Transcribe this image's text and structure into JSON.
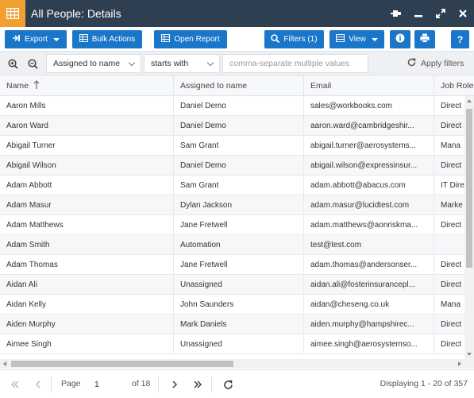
{
  "window": {
    "title": "All People: Details",
    "icons": {
      "app": "grid-table-icon",
      "pin": "pin-icon",
      "minimize": "minimize-icon",
      "maximize": "expand-icon",
      "close": "close-icon"
    }
  },
  "colors": {
    "titlebar": "#2f3f52",
    "app_icon_bg": "#f0a030",
    "button": "#1976c8"
  },
  "toolbar": {
    "export_label": "Export",
    "bulk_actions_label": "Bulk Actions",
    "open_report_label": "Open Report",
    "filters_label": "Filters (1)",
    "view_label": "View"
  },
  "filter": {
    "field_value": "Assigned to name",
    "operator_value": "starts with",
    "value_placeholder": "comma-separate multiple values",
    "apply_label": "Apply filters"
  },
  "grid": {
    "columns": [
      "Name",
      "Assigned to name",
      "Email",
      "Job Role"
    ],
    "rows": [
      [
        "Aaron Mills",
        "Daniel Demo",
        "sales@workbooks.com",
        "Direct"
      ],
      [
        "Aaron Ward",
        "Daniel Demo",
        "aaron.ward@cambridgeshir...",
        "Direct"
      ],
      [
        "Abigail Turner",
        "Sam Grant",
        "abigail.turner@aerosystems...",
        "Mana"
      ],
      [
        "Abigail Wilson",
        "Daniel Demo",
        "abigail.wilson@expressinsur...",
        "Direct"
      ],
      [
        "Adam Abbott",
        "Sam Grant",
        "adam.abbott@abacus.com",
        "IT Dire"
      ],
      [
        "Adam Masur",
        "Dylan Jackson",
        "adam.masur@lucidtest.com",
        "Marke"
      ],
      [
        "Adam Matthews",
        "Jane Fretwell",
        "adam.matthews@aonriskma...",
        "Direct"
      ],
      [
        "Adam Smith",
        "Automation",
        "test@test.com",
        ""
      ],
      [
        "Adam Thomas",
        "Jane Fretwell",
        "adam.thomas@andersonser...",
        "Direct"
      ],
      [
        "Aidan Ali",
        "Unassigned",
        "aidan.ali@fosterinsurancepl...",
        "Direct"
      ],
      [
        "Aidan Kelly",
        "John Saunders",
        "aidan@cheseng.co.uk",
        "Mana"
      ],
      [
        "Aiden Murphy",
        "Mark Daniels",
        "aiden.murphy@hampshirec...",
        "Direct"
      ],
      [
        "Aimee Singh",
        "Unassigned",
        "aimee.singh@aerosystemso...",
        "Direct"
      ]
    ]
  },
  "pager": {
    "page_label": "Page",
    "page_value": "1",
    "of_label": "of 18",
    "display_text": "Displaying 1 - 20 of 357"
  }
}
